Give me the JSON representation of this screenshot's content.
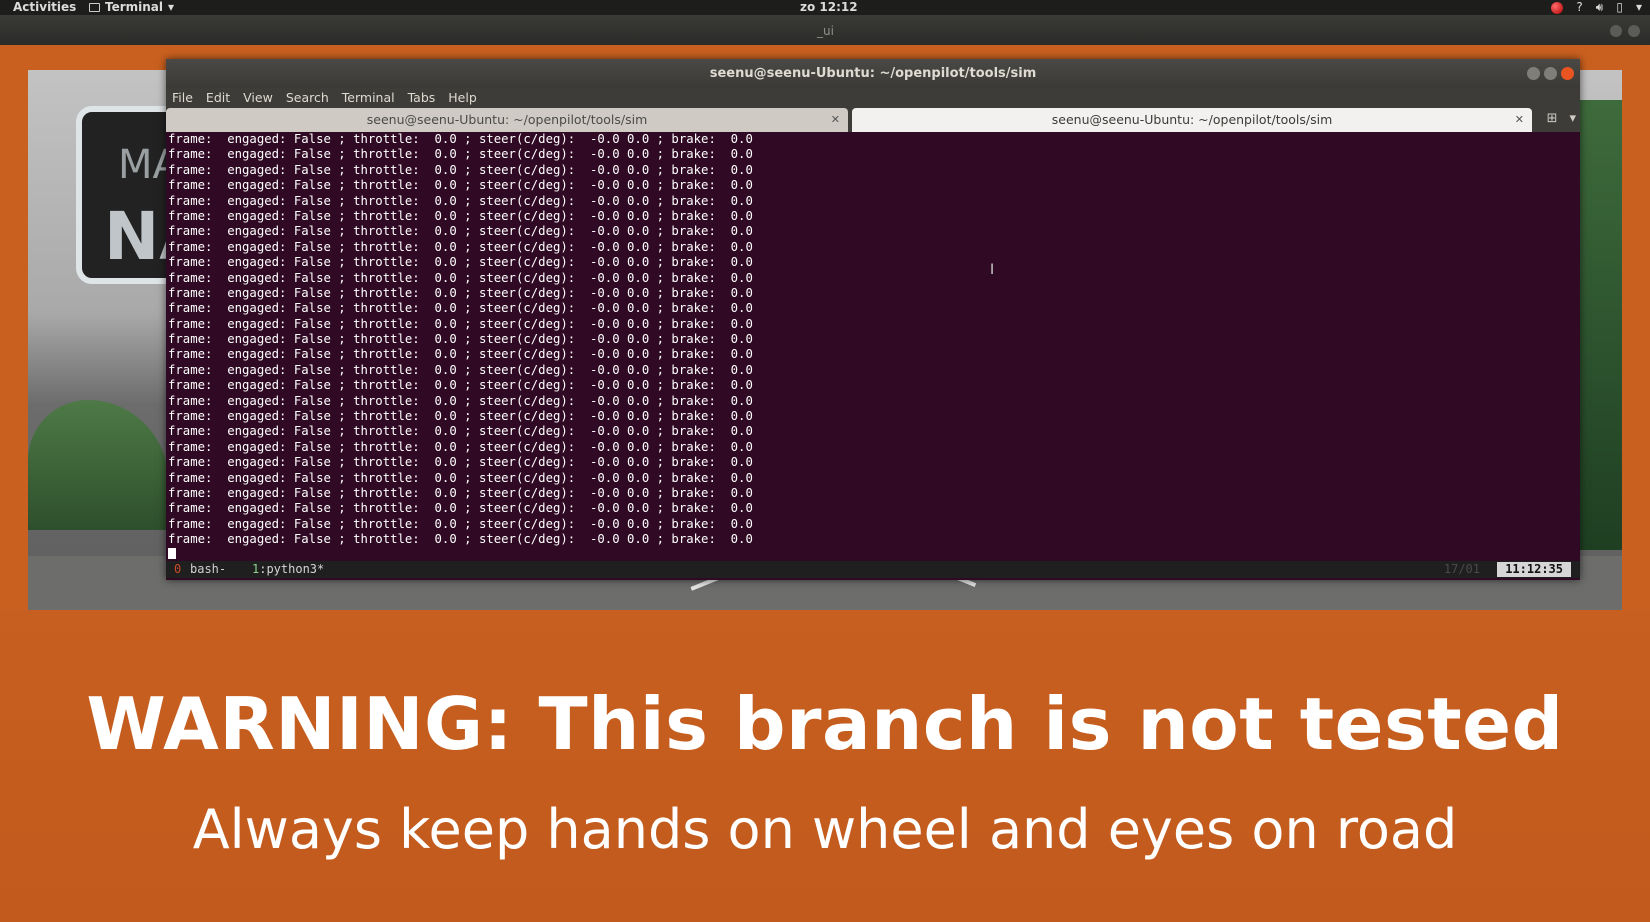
{
  "topbar": {
    "activities": "Activities",
    "app_menu": "Terminal",
    "clock": "zo 12:12",
    "help_icon": "?"
  },
  "outer_window": {
    "title": "_ui"
  },
  "scene": {
    "sign_line1": "MA",
    "sign_line2": "NA"
  },
  "terminal": {
    "title": "seenu@seenu-Ubuntu: ~/openpilot/tools/sim",
    "menu": [
      "File",
      "Edit",
      "View",
      "Search",
      "Terminal",
      "Tabs",
      "Help"
    ],
    "tabs": [
      {
        "label": "seenu@seenu-Ubuntu: ~/openpilot/tools/sim",
        "active": false
      },
      {
        "label": "seenu@seenu-Ubuntu: ~/openpilot/tools/sim",
        "active": true
      }
    ],
    "output_line": "frame:  engaged: False ; throttle:  0.0 ; steer(c/deg):  -0.0 0.0 ; brake:  0.0",
    "output_lines_count": 27,
    "status": {
      "win0": "0",
      "win0_label": "bash-",
      "win1_index": "1",
      "win1_label": ":python3*",
      "dim_text": "17/01",
      "time": "11:12:35"
    }
  },
  "banner": {
    "headline": "WARNING: This branch is not tested",
    "subline": "Always keep hands on wheel and eyes on road"
  },
  "colors": {
    "terminal_bg": "#300a24",
    "banner_bg": "#c75f20",
    "close_button": "#e95420"
  }
}
